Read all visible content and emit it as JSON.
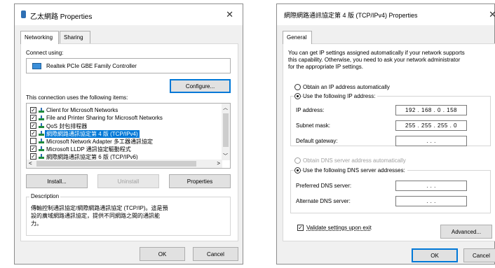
{
  "left_dialog": {
    "title": "乙太網路 Properties",
    "close": "✕",
    "tabs": [
      "Networking",
      "Sharing"
    ],
    "connect_using_label": "Connect using:",
    "adapter_name": "Realtek PCIe GBE Family Controller",
    "configure_button": "Configure...",
    "items_label": "This connection uses the following items:",
    "items": [
      {
        "label": "Client for Microsoft Networks",
        "checked": true,
        "icon": "network-client-icon"
      },
      {
        "label": "File and Printer Sharing for Microsoft Networks",
        "checked": true,
        "icon": "file-sharing-icon"
      },
      {
        "label": "QoS 封包排程器",
        "checked": true,
        "icon": "qos-icon"
      },
      {
        "label": "網際網路通訊協定第 4 版 (TCP/IPv4)",
        "checked": true,
        "icon": "protocol-icon",
        "selected": true
      },
      {
        "label": "Microsoft Network Adapter 多工器通訊協定",
        "checked": false,
        "icon": "protocol-icon"
      },
      {
        "label": "Microsoft LLDP 通訊協定驅動程式",
        "checked": true,
        "icon": "protocol-icon"
      },
      {
        "label": "網際網路通訊協定第 6 版 (TCP/IPv6)",
        "checked": true,
        "icon": "protocol-icon"
      }
    ],
    "install_button": "Install...",
    "uninstall_button": "Uninstall",
    "properties_button": "Properties",
    "description_label": "Description",
    "description_text_1": "傳輸控制通訊協定/網際網路通訊協定 (TCP/IP)。這是預",
    "description_text_2": "設的廣域網路通訊協定，提供不同網路之間的通訊能",
    "description_text_3": "力。",
    "ok_button": "OK",
    "cancel_button": "Cancel"
  },
  "right_dialog": {
    "title": "網際網路通訊協定第 4 版 (TCP/IPv4) Properties",
    "close": "✕",
    "tab": "General",
    "intro_1": "You can get IP settings assigned automatically if your network supports",
    "intro_2": "this capability. Otherwise, you need to ask your network administrator",
    "intro_3": "for the appropriate IP settings.",
    "obtain_ip_auto": "Obtain an IP address automatically",
    "use_following_ip": "Use the following IP address:",
    "ip_address_label": "IP address:",
    "ip_address_value": "192 . 168 .  0  . 158",
    "subnet_mask_label": "Subnet mask:",
    "subnet_mask_value": "255 . 255 . 255 .  0",
    "default_gateway_label": "Default gateway:",
    "default_gateway_value": ".       .       .",
    "obtain_dns_auto": "Obtain DNS server address automatically",
    "use_following_dns": "Use the following DNS server addresses:",
    "preferred_dns_label": "Preferred DNS server:",
    "preferred_dns_value": ".       .       .",
    "alternate_dns_label": "Alternate DNS server:",
    "alternate_dns_value": ".       .       .",
    "validate_label": "Validate settings upon exit",
    "advanced_button": "Advanced...",
    "ok_button": "OK",
    "cancel_button": "Cancel"
  }
}
